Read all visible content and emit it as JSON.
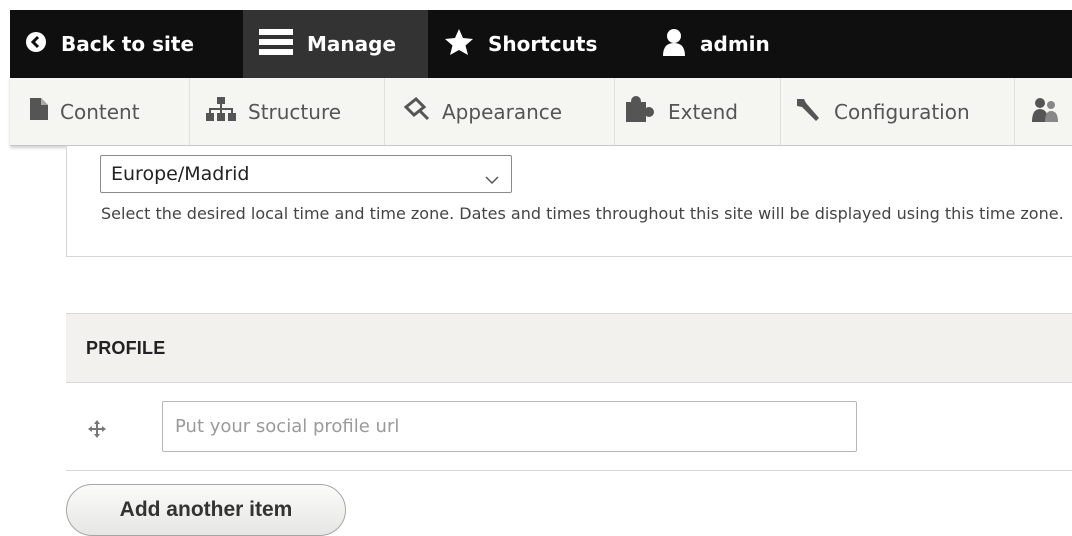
{
  "toolbar": {
    "back_label": "Back to site",
    "manage_label": "Manage",
    "shortcuts_label": "Shortcuts",
    "user_label": "admin"
  },
  "tray": {
    "items": [
      {
        "label": "Content",
        "icon": "document-icon"
      },
      {
        "label": "Structure",
        "icon": "sitemap-icon"
      },
      {
        "label": "Appearance",
        "icon": "paintbrush-icon"
      },
      {
        "label": "Extend",
        "icon": "puzzle-icon"
      },
      {
        "label": "Configuration",
        "icon": "wrench-icon"
      },
      {
        "label": "",
        "icon": "people-icon"
      }
    ]
  },
  "timezone": {
    "selected": "Europe/Madrid",
    "description": "Select the desired local time and time zone. Dates and times throughout this site will be displayed using this time zone."
  },
  "profile": {
    "title": "PROFILE",
    "url_placeholder": "Put your social profile url",
    "url_value": ""
  },
  "actions": {
    "add_another_label": "Add another item"
  },
  "colors": {
    "toolbar_bg": "#0f0f0f",
    "toolbar_active": "#333333",
    "tray_bg": "#f5f5f2",
    "section_head_bg": "#f2f1ed"
  }
}
